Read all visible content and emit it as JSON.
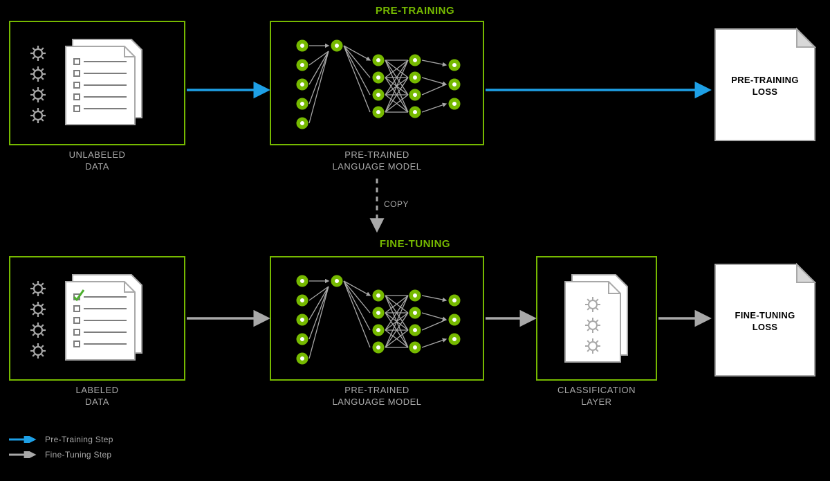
{
  "rows": {
    "pretraining": "PRE-TRAINING",
    "finetuning": "FINE-TUNING"
  },
  "boxes": {
    "unlabeled_data": "UNLABELED\nDATA",
    "labeled_data": "LABELED\nDATA",
    "pretrain_model": "PRE-TRAINED\nLANGUAGE MODEL",
    "classification_layer": "CLASSIFICATION\nLAYER"
  },
  "documents": {
    "pretraining_loss": "PRE-TRAINING\nLOSS",
    "finetuning_loss": "FINE-TUNING\nLOSS"
  },
  "legend": {
    "pretraining_step": "Pre-Training Step",
    "finetuning_step": "Fine-Tuning Step"
  },
  "copy_text": "COPY",
  "colors": {
    "green": "#76b900",
    "blue": "#1ea0e6",
    "gray": "#a8a8a8",
    "dark_gray": "#7d7d7d"
  }
}
